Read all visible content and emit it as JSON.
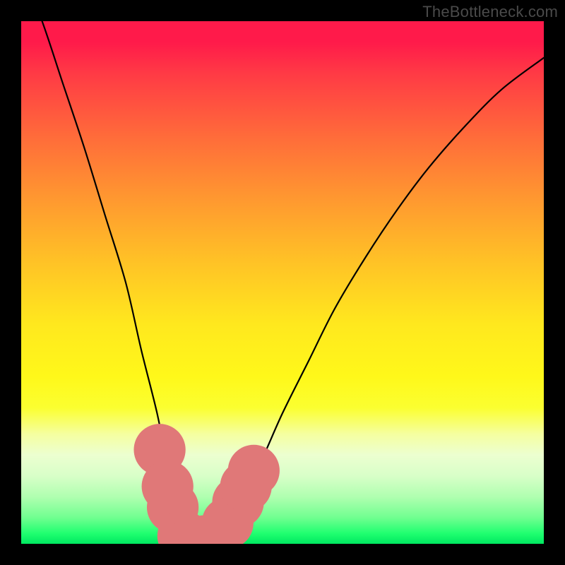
{
  "watermark": "TheBottleneck.com",
  "chart_data": {
    "type": "line",
    "title": "",
    "xlabel": "",
    "ylabel": "",
    "xlim": [
      0,
      100
    ],
    "ylim": [
      0,
      100
    ],
    "grid": false,
    "background_gradient": {
      "direction": "vertical",
      "stops": [
        {
          "pos": 0,
          "color": "#ff1a4a"
        },
        {
          "pos": 22,
          "color": "#ff6b3a"
        },
        {
          "pos": 46,
          "color": "#ffc226"
        },
        {
          "pos": 68,
          "color": "#fff81a"
        },
        {
          "pos": 87,
          "color": "#d8ffc8"
        },
        {
          "pos": 100,
          "color": "#00e860"
        }
      ]
    },
    "series": [
      {
        "name": "bottleneck-curve",
        "x": [
          0,
          4,
          8,
          12,
          16,
          20,
          23,
          26,
          28,
          30,
          32,
          34,
          36,
          38,
          42,
          46,
          50,
          55,
          60,
          66,
          72,
          78,
          85,
          92,
          100
        ],
        "values": [
          110,
          100,
          88,
          76,
          63,
          50,
          37,
          25,
          15,
          7,
          2,
          0,
          0,
          2,
          8,
          16,
          25,
          35,
          45,
          55,
          64,
          72,
          80,
          87,
          93
        ]
      }
    ],
    "markers": {
      "name": "highlight-points",
      "color": "#e07878",
      "radius": 9,
      "points": [
        {
          "x": 26.5,
          "y": 18
        },
        {
          "x": 28,
          "y": 11
        },
        {
          "x": 29,
          "y": 7
        },
        {
          "x": 31,
          "y": 1.5
        },
        {
          "x": 33,
          "y": 0.5
        },
        {
          "x": 35,
          "y": 0.5
        },
        {
          "x": 37,
          "y": 0.8
        },
        {
          "x": 39.5,
          "y": 4
        },
        {
          "x": 41.5,
          "y": 8
        },
        {
          "x": 43,
          "y": 11
        },
        {
          "x": 44.5,
          "y": 14
        }
      ]
    }
  }
}
